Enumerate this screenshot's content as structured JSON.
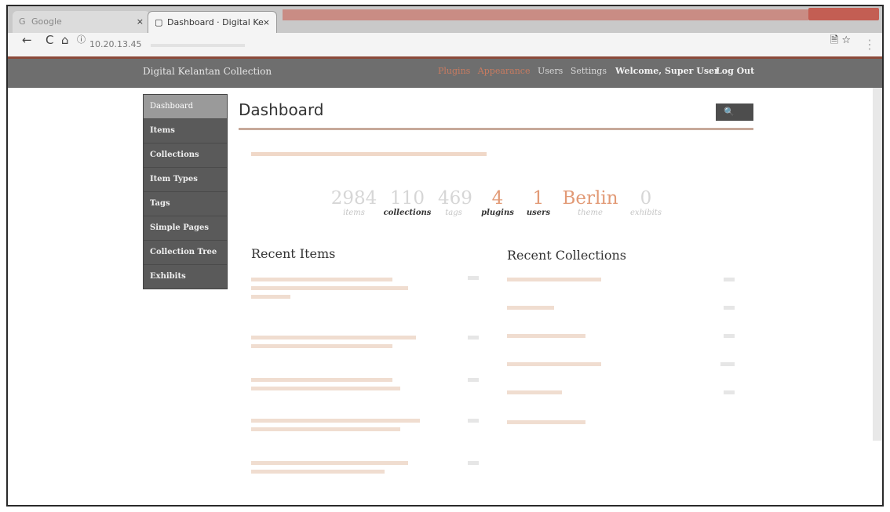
{
  "browser": {
    "tabs": [
      {
        "label": "Google",
        "active": false
      },
      {
        "label": "Dashboard · Digital Ke",
        "active": true
      }
    ],
    "address": {
      "url": "10.20.13.45"
    },
    "icons": {
      "back": "arrow-left-icon",
      "reload": "reload-icon",
      "home": "home-icon",
      "info": "info-icon",
      "star": "star-icon"
    }
  },
  "header": {
    "site_title": "Digital Kelantan Collection",
    "nav": [
      "Plugins",
      "Appearance",
      "Users",
      "Settings"
    ],
    "welcome": "Welcome, Super User",
    "logout": "Log Out"
  },
  "sidebar": {
    "items": [
      {
        "label": "Dashboard",
        "active": true
      },
      {
        "label": "Items"
      },
      {
        "label": "Collections"
      },
      {
        "label": "Item Types"
      },
      {
        "label": "Tags"
      },
      {
        "label": "Simple Pages"
      },
      {
        "label": "Collection Tree"
      },
      {
        "label": "Exhibits"
      }
    ]
  },
  "main": {
    "title": "Dashboard",
    "search_icon": "search-icon",
    "stats": [
      {
        "value": "2984",
        "label": "items"
      },
      {
        "value": "110",
        "label": "collections"
      },
      {
        "value": "469",
        "label": "tags"
      },
      {
        "value": "4",
        "label": "plugins"
      },
      {
        "value": "1",
        "label": "users"
      },
      {
        "value": "Berlin",
        "label": "theme"
      },
      {
        "value": "0",
        "label": "exhibits"
      }
    ],
    "recent_items_title": "Recent Items",
    "recent_collections_title": "Recent Collections"
  },
  "colors": {
    "accent": "#e29a76",
    "admin_bar": "#6e6e6e",
    "sidebar": "#5a5a5a"
  }
}
